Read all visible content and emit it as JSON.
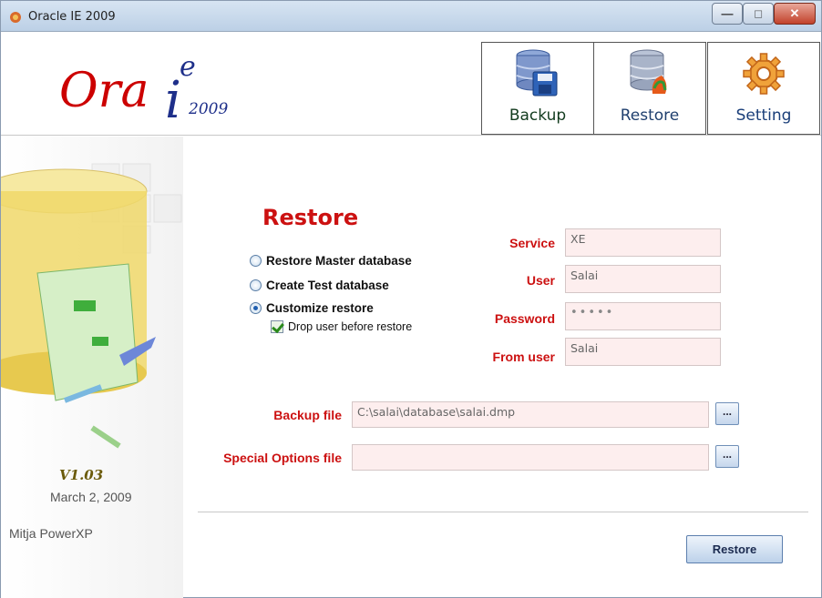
{
  "window": {
    "title": "Oracle IE 2009",
    "controls": [
      "minimize",
      "maximize",
      "close"
    ]
  },
  "logo": {
    "ora": "Ora",
    "i": "i",
    "e": "e",
    "year": "2009"
  },
  "nav": {
    "backup": {
      "label": "Backup",
      "icon": "database-save-icon"
    },
    "restore": {
      "label": "Restore",
      "icon": "database-restore-icon"
    },
    "setting": {
      "label": "Setting",
      "icon": "gear-icon"
    }
  },
  "sidebar": {
    "version": "V1.03",
    "date": "March 2, 2009",
    "author": "Mitja PowerXP"
  },
  "form": {
    "heading": "Restore",
    "options": [
      {
        "label": "Restore Master database",
        "selected": false
      },
      {
        "label": "Create Test database",
        "selected": false
      },
      {
        "label": "Customize restore",
        "selected": true
      }
    ],
    "drop_user": {
      "label": "Drop user before restore",
      "checked": true
    },
    "service": {
      "label": "Service",
      "value": "XE"
    },
    "user": {
      "label": "User",
      "value": "Salai"
    },
    "password": {
      "label": "Password",
      "value": "•••••"
    },
    "from_user": {
      "label": "From user",
      "value": "Salai"
    },
    "backup_file": {
      "label": "Backup file",
      "value": "C:\\salai\\database\\salai.dmp",
      "browse": "..."
    },
    "special_options": {
      "label": "Special Options file",
      "value": "",
      "browse": "..."
    },
    "restore_button": "Restore"
  },
  "colors": {
    "accent_red": "#cc1111",
    "field_bg": "#fdeeee",
    "title_bar": "#bcd0e6"
  }
}
